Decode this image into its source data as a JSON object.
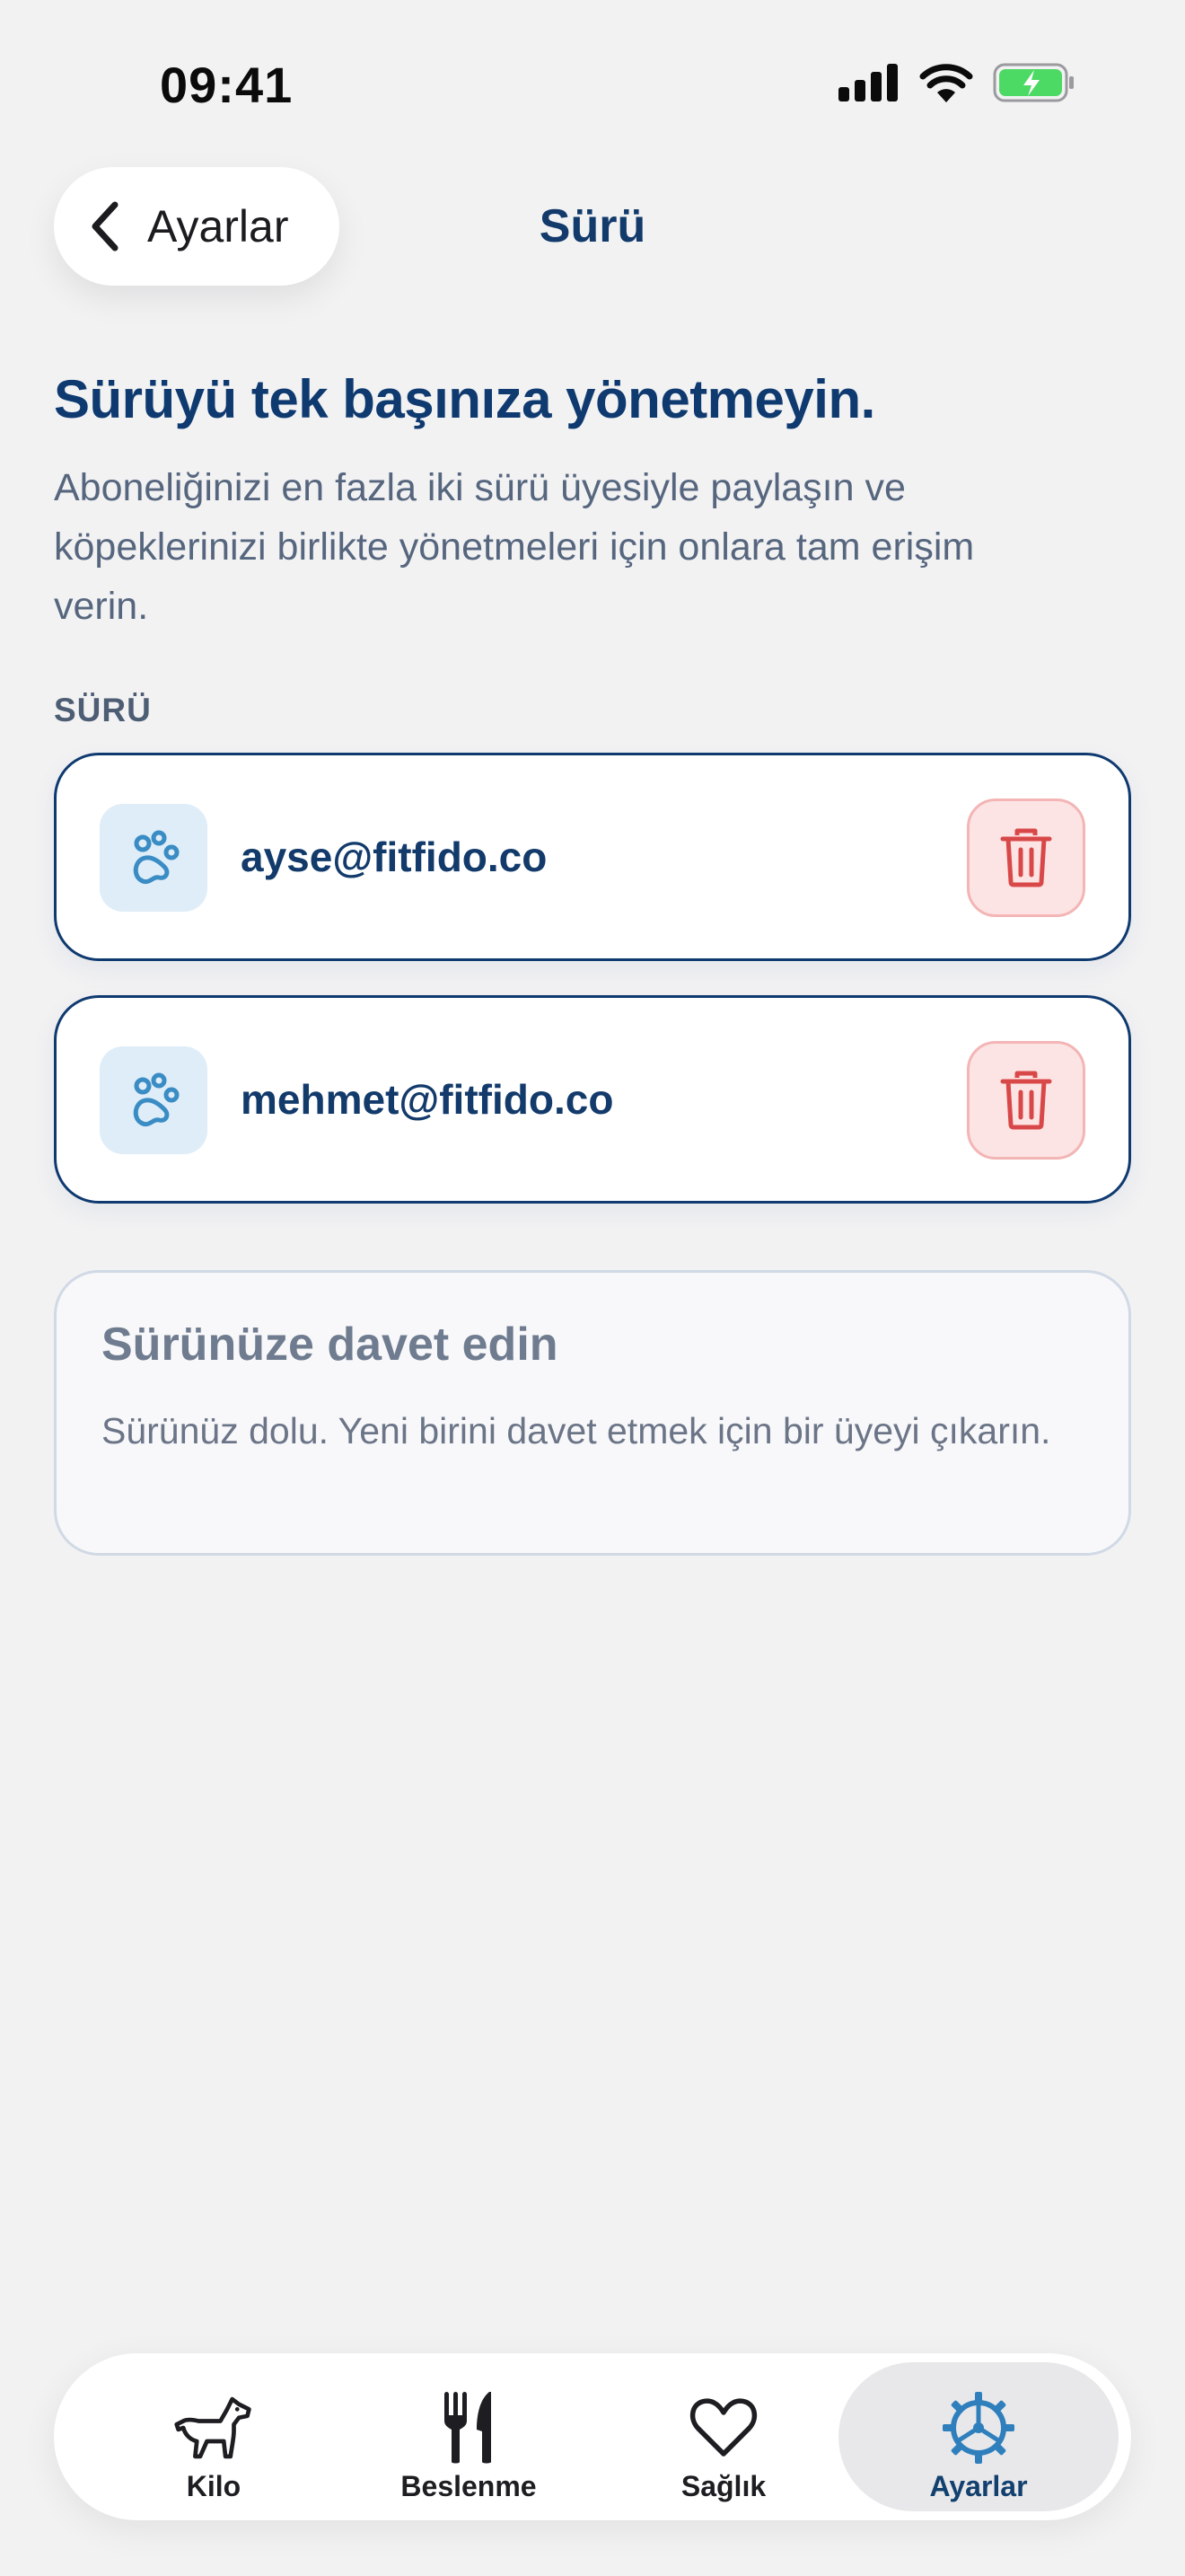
{
  "status_bar": {
    "time": "09:41"
  },
  "nav": {
    "back_label": "Ayarlar",
    "title": "Sürü"
  },
  "header": {
    "headline": "Sürüyü tek başınıza yönetmeyin.",
    "subtitle": "Aboneliğinizi en fazla iki sürü üyesiyle paylaşın ve köpeklerinizi birlikte yönetmeleri için onlara tam erişim verin."
  },
  "section_label": "SÜRÜ",
  "members": [
    {
      "email": "ayse@fitfido.co",
      "icon": "paw-icon"
    },
    {
      "email": "mehmet@fitfido.co",
      "icon": "paw-icon"
    }
  ],
  "invite": {
    "title": "Sürünüze davet edin",
    "description": "Sürünüz dolu. Yeni birini davet etmek için bir üyeyi çıkarın."
  },
  "tabs": [
    {
      "label": "Kilo",
      "icon": "dog-icon"
    },
    {
      "label": "Beslenme",
      "icon": "fork-knife-icon"
    },
    {
      "label": "Sağlık",
      "icon": "heart-icon"
    },
    {
      "label": "Ayarlar",
      "icon": "gear-icon",
      "active": true
    }
  ],
  "colors": {
    "accent": "#0f3a70",
    "danger": "#d94848",
    "danger_bg": "#fde4e4",
    "icon_bg": "#deedf8",
    "icon_blue": "#3a8cc4",
    "battery_green": "#4cd964"
  }
}
